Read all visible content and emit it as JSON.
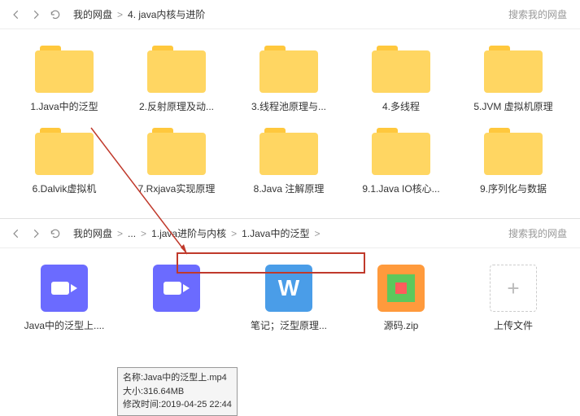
{
  "top": {
    "breadcrumb": {
      "root": "我的网盘",
      "current": "4. java内核与进阶"
    },
    "search_placeholder": "搜索我的网盘",
    "folders": [
      {
        "label": "1.Java中的泛型"
      },
      {
        "label": "2.反射原理及动..."
      },
      {
        "label": "3.线程池原理与..."
      },
      {
        "label": "4.多线程"
      },
      {
        "label": "5.JVM 虚拟机原理"
      },
      {
        "label": "6.Dalvik虚拟机"
      },
      {
        "label": "7.Rxjava实现原理"
      },
      {
        "label": "8.Java 注解原理"
      },
      {
        "label": "9.1.Java IO核心..."
      },
      {
        "label": "9.序列化与数据"
      }
    ]
  },
  "bottom": {
    "breadcrumb": {
      "root": "我的网盘",
      "ellipsis": "...",
      "mid": "1.java进阶与内核",
      "leaf": "1.Java中的泛型"
    },
    "search_placeholder": "搜索我的网盘",
    "items": [
      {
        "label": "Java中的泛型上....",
        "type": "video"
      },
      {
        "label": "",
        "type": "video"
      },
      {
        "label": "笔记；泛型原理...",
        "type": "word"
      },
      {
        "label": "源码.zip",
        "type": "zip"
      },
      {
        "label": "上传文件",
        "type": "upload"
      }
    ]
  },
  "tooltip": {
    "name_label": "名称:",
    "name_value": "Java中的泛型上.mp4",
    "size_label": "大小:",
    "size_value": "316.64MB",
    "mtime_label": "修改时间:",
    "mtime_value": "2019-04-25 22:44"
  }
}
